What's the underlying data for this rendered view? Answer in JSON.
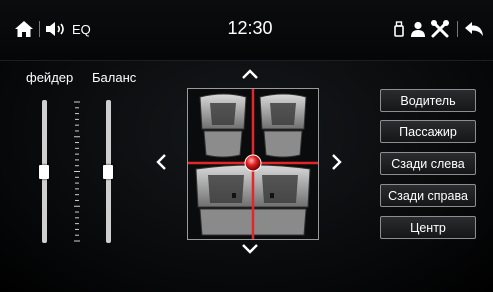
{
  "status_bar": {
    "eq_label": "EQ",
    "time": "12:30"
  },
  "faders": {
    "fader_label": "фейдер",
    "balance_label": "Баланс",
    "fader_level": 0.5,
    "balance_level": 0.5
  },
  "seat_buttons": [
    {
      "label": "Водитель"
    },
    {
      "label": "Пассажир"
    },
    {
      "label": "Сзади слева"
    },
    {
      "label": "Сзади справа"
    },
    {
      "label": "Центр"
    }
  ],
  "colors": {
    "crosshair": "#e0282a",
    "accent_text": "#ffffff"
  },
  "icons": [
    "home-icon",
    "volume-icon",
    "usb-icon",
    "user-icon",
    "tools-icon",
    "back-icon",
    "chevron-up-icon",
    "chevron-down-icon",
    "chevron-left-icon",
    "chevron-right-icon"
  ]
}
